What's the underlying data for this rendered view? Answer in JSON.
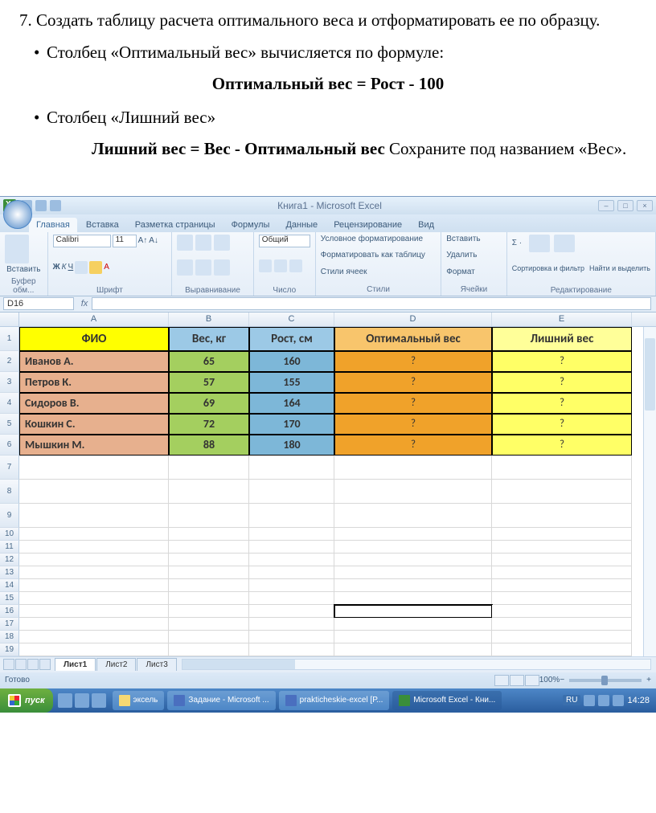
{
  "doc": {
    "main_para": "7.  Создать  таблицу  расчета  оптимального  веса  и отформатировать ее по образцу.",
    "bullet1": "Столбец «Оптимальный вес» вычисляется по формуле:",
    "formula1": "Оптимальный вес = Рост - 100",
    "bullet2": "Столбец «Лишний вес»",
    "formula2_bold": "Лишний вес = Вес - Оптимальный вес",
    "formula2_tail": " Сохраните под названием «Вес»."
  },
  "excel": {
    "title": "Книга1 - Microsoft Excel",
    "tabs": [
      "Главная",
      "Вставка",
      "Разметка страницы",
      "Формулы",
      "Данные",
      "Рецензирование",
      "Вид"
    ],
    "font_name": "Calibri",
    "font_size": "11",
    "groups": {
      "clipboard": "Буфер обм...",
      "clipboard_btn": "Вставить",
      "font": "Шрифт",
      "align": "Выравнивание",
      "number": "Число",
      "number_fmt": "Общий",
      "styles": "Стили",
      "styles_items": [
        "Условное форматирование",
        "Форматировать как таблицу",
        "Стили ячеек"
      ],
      "cells": "Ячейки",
      "cells_items": [
        "Вставить",
        "Удалить",
        "Формат"
      ],
      "edit": "Редактирование",
      "edit_items": [
        "Сортировка и фильтр",
        "Найти и выделить"
      ]
    },
    "namebox": "D16",
    "columns": [
      "A",
      "B",
      "C",
      "D",
      "E"
    ],
    "headers": {
      "A": "ФИО",
      "B": "Вес, кг",
      "C": "Рост, см",
      "D": "Оптимальный вес",
      "E": "Лишний вес"
    },
    "rows": [
      {
        "name": "Иванов А.",
        "weight": "65",
        "height": "160",
        "opt": "?",
        "ext": "?"
      },
      {
        "name": "Петров К.",
        "weight": "57",
        "height": "155",
        "opt": "?",
        "ext": "?"
      },
      {
        "name": "Сидоров В.",
        "weight": "69",
        "height": "164",
        "opt": "?",
        "ext": "?"
      },
      {
        "name": "Кошкин С.",
        "weight": "72",
        "height": "170",
        "opt": "?",
        "ext": "?"
      },
      {
        "name": "Мышкин М.",
        "weight": "88",
        "height": "180",
        "opt": "?",
        "ext": "?"
      }
    ],
    "sheets": [
      "Лист1",
      "Лист2",
      "Лист3"
    ],
    "status": "Готово",
    "zoom": "100%"
  },
  "taskbar": {
    "start": "пуск",
    "tasks": [
      {
        "label": "эксель"
      },
      {
        "label": "Задание - Microsoft ..."
      },
      {
        "label": "prakticheskie-excel [Р..."
      },
      {
        "label": "Microsoft Excel - Кни..."
      }
    ],
    "lang": "RU",
    "clock": "14:28"
  }
}
